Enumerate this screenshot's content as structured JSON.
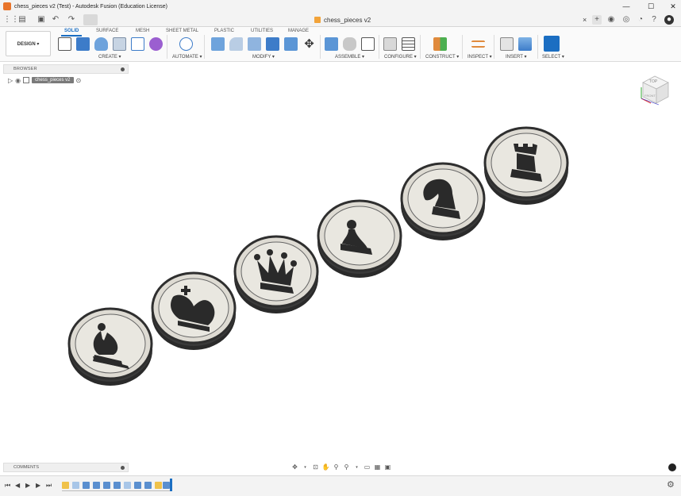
{
  "window": {
    "title": "chess_pieces v2 (Test) - Autodesk Fusion (Education License)",
    "controls": [
      "minimize",
      "maximize",
      "close"
    ]
  },
  "quick_access": {
    "doc_tab": "chess_pieces v2",
    "tab_close": "×",
    "right_icons": [
      "new-tab-icon",
      "extensions-icon",
      "job-status-icon",
      "notifications-icon",
      "help-icon",
      "user-avatar-icon"
    ]
  },
  "ribbon": {
    "workspace": "DESIGN ▾",
    "tabs": [
      "SOLID",
      "SURFACE",
      "MESH",
      "SHEET METAL",
      "PLASTIC",
      "UTILITIES",
      "MANAGE"
    ],
    "active_tab": "SOLID",
    "groups": [
      "CREATE ▾",
      "AUTOMATE ▾",
      "MODIFY ▾",
      "ASSEMBLE ▾",
      "CONFIGURE ▾",
      "CONSTRUCT ▾",
      "INSPECT ▾",
      "INSERT ▾",
      "SELECT ▾"
    ]
  },
  "browser": {
    "title": "BROWSER",
    "root_node": "chess_pieces v2"
  },
  "viewcube": {
    "face_top": "TOP",
    "face_front": "FRONT"
  },
  "comments": {
    "title": "COMMENTS"
  },
  "scene": {
    "pieces": [
      "bishop",
      "king",
      "queen",
      "pawn",
      "knight",
      "rook"
    ],
    "token_color": "#e8e6df",
    "piece_color": "#2a2a2a"
  },
  "timeline": {
    "controls": [
      "⏮",
      "◀",
      "▶",
      "▶",
      "⏭"
    ],
    "features": [
      "sketch",
      "light",
      "feature",
      "feature",
      "feature",
      "feature",
      "light",
      "feature",
      "feature",
      "feature",
      "feature",
      "sketch",
      "feature"
    ]
  }
}
